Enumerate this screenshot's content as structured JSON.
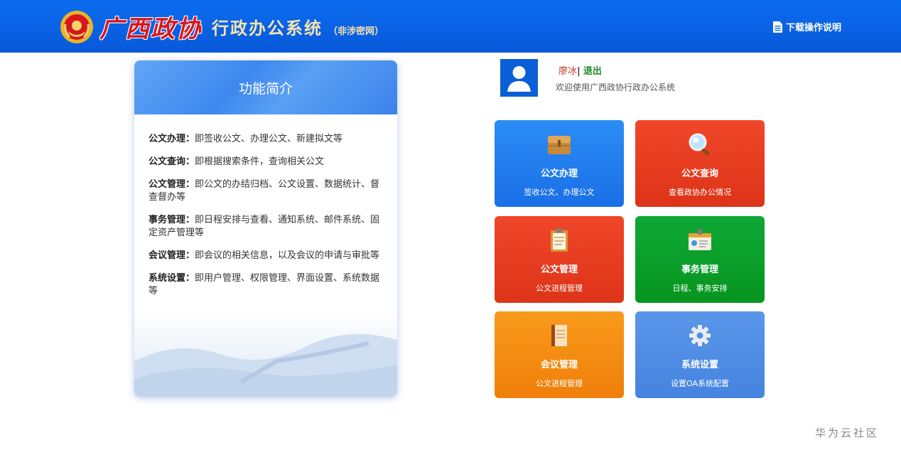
{
  "header": {
    "brand_script": "广西政协",
    "title": "行政办公系统",
    "subtitle": "（非涉密网）",
    "download_label": "下载操作说明"
  },
  "intro": {
    "heading": "功能简介",
    "items": [
      {
        "label": "公文办理",
        "text": "即签收公文、办理公文、新建拟文等"
      },
      {
        "label": "公文查询",
        "text": "即根据搜索条件，查询相关公文"
      },
      {
        "label": "公文管理",
        "text": "即公文的办结归档、公文设置、数据统计、督查督办等"
      },
      {
        "label": "事务管理",
        "text": "即日程安排与查看、通知系统、邮件系统、固定资产管理等"
      },
      {
        "label": "会议管理",
        "text": "即会议的相关信息，以及会议的申请与审批等"
      },
      {
        "label": "系统设置",
        "text": "即用户管理、权限管理、界面设置、系统数据等"
      }
    ],
    "colon": "："
  },
  "user": {
    "name": "廖冰",
    "separator": "|",
    "logout_label": "退出",
    "welcome": "欢迎使用广西政协行政办公系统"
  },
  "tiles": [
    {
      "title": "公文办理",
      "desc": "签收公文、办理公文",
      "icon": "briefcase-icon",
      "color": "#1f78ea"
    },
    {
      "title": "公文查询",
      "desc": "查看政协办公情况",
      "icon": "magnifier-icon",
      "color": "#e53a1e"
    },
    {
      "title": "公文管理",
      "desc": "公文进程管理",
      "icon": "clipboard-icon",
      "color": "#e53a1e"
    },
    {
      "title": "事务管理",
      "desc": "日程、事务安排",
      "icon": "id-card-icon",
      "color": "#09a02a"
    },
    {
      "title": "会议管理",
      "desc": "公文进程管理",
      "icon": "book-icon",
      "color": "#f38b12"
    },
    {
      "title": "系统设置",
      "desc": "设置OA系统配置",
      "icon": "gear-icon",
      "color": "#4f8de5"
    }
  ],
  "watermark": "华为云社区"
}
